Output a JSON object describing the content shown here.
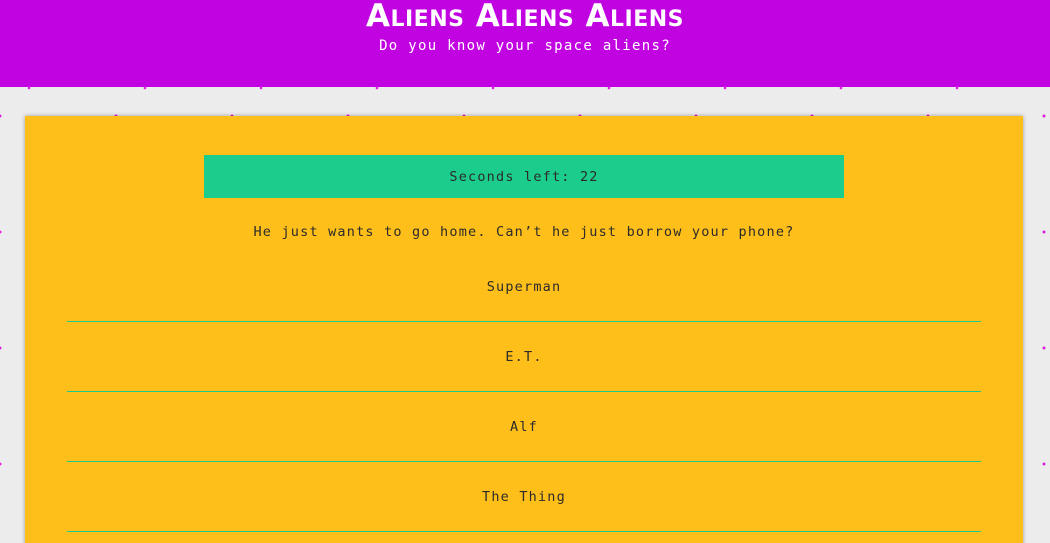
{
  "header": {
    "title": "Aliens Aliens Aliens",
    "subtitle": "Do you know your space aliens?"
  },
  "quiz": {
    "timer_text": "Seconds left: 22",
    "question": "He just wants to go home. Can’t he just borrow your phone?",
    "answers": [
      "Superman",
      "E.T.",
      "Alf",
      "The Thing"
    ]
  },
  "colors": {
    "header_bg": "#c103e2",
    "card_bg": "#ffbf1b",
    "accent_green": "#1ccc8c",
    "dot_magenta": "#e01be0",
    "page_bg": "#ececec"
  }
}
